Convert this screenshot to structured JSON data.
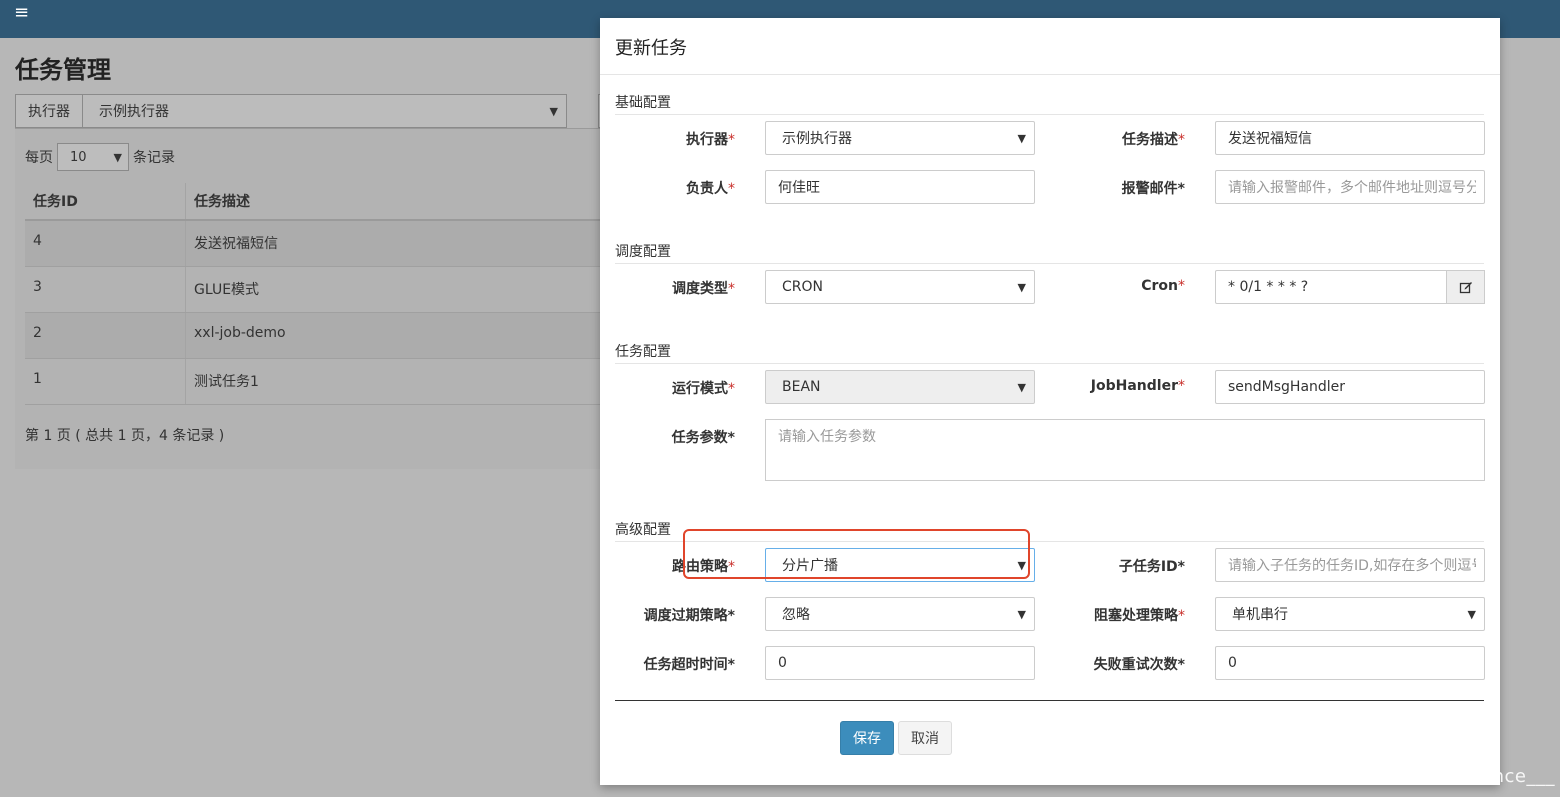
{
  "page": {
    "title": "任务管理",
    "filter": {
      "executor_label": "执行器",
      "executor_value": "示例执行器"
    },
    "page_size": {
      "prefix": "每页",
      "value": "10",
      "suffix": "条记录"
    },
    "table": {
      "headers": [
        "任务ID",
        "任务描述"
      ],
      "rows": [
        {
          "id": "4",
          "desc": "发送祝福短信"
        },
        {
          "id": "3",
          "desc": "GLUE模式"
        },
        {
          "id": "2",
          "desc": "xxl-job-demo"
        },
        {
          "id": "1",
          "desc": "测试任务1"
        }
      ]
    },
    "pager_info": "第 1 页 ( 总共 1 页，4 条记录 )"
  },
  "modal": {
    "title": "更新任务",
    "sections": {
      "basic": "基础配置",
      "schedule": "调度配置",
      "task": "任务配置",
      "advanced": "高级配置"
    },
    "fields": {
      "executor": {
        "label": "执行器",
        "value": "示例执行器"
      },
      "job_desc": {
        "label": "任务描述",
        "value": "发送祝福短信"
      },
      "author": {
        "label": "负责人",
        "value": "何佳旺"
      },
      "alarm_email": {
        "label": "报警邮件*",
        "placeholder": "请输入报警邮件，多个邮件地址则逗号分"
      },
      "schedule_type": {
        "label": "调度类型",
        "value": "CRON"
      },
      "cron": {
        "label": "Cron",
        "value": "* 0/1 * * * ?"
      },
      "glue_type": {
        "label": "运行模式",
        "value": "BEAN"
      },
      "job_handler": {
        "label": "JobHandler",
        "value": "sendMsgHandler"
      },
      "job_param": {
        "label": "任务参数*",
        "placeholder": "请输入任务参数"
      },
      "route_strategy": {
        "label": "路由策略",
        "value": "分片广播"
      },
      "child_job": {
        "label": "子任务ID*",
        "placeholder": "请输入子任务的任务ID,如存在多个则逗号"
      },
      "misfire": {
        "label": "调度过期策略*",
        "value": "忽略"
      },
      "block_strategy": {
        "label": "阻塞处理策略",
        "value": "单机串行"
      },
      "timeout": {
        "label": "任务超时时间*",
        "value": "0"
      },
      "retry": {
        "label": "失败重试次数*",
        "value": "0"
      }
    },
    "required_mark": "*",
    "buttons": {
      "save": "保存",
      "cancel": "取消"
    }
  },
  "watermark": "CSDN @Persistence___",
  "icons": {
    "menu": "menu-icon",
    "dropdown": "chevron-down-icon",
    "edit": "edit-icon"
  },
  "colors": {
    "topbar": "#2f5875",
    "primary": "#3c8dbc",
    "required": "#c9302c",
    "highlight": "#e0452b"
  }
}
